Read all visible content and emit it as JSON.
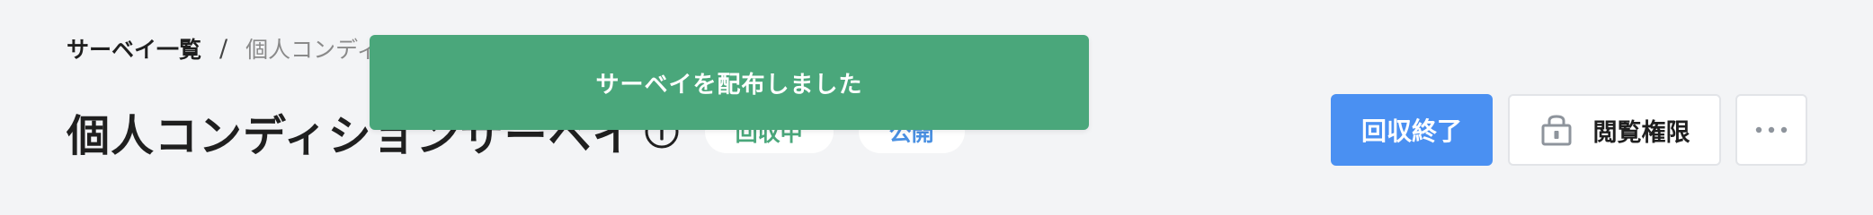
{
  "breadcrumb": {
    "parent": "サーベイ一覧",
    "separator": "/",
    "current": "個人コンディ"
  },
  "header": {
    "title": "個人コンディションサーベイ",
    "status_badge": "回収中",
    "visibility_badge": "公開"
  },
  "toast": {
    "message": "サーベイを配布しました"
  },
  "actions": {
    "close_collection": "回収終了",
    "view_permission": "閲覧権限"
  },
  "icons": {
    "info": "info-icon",
    "lock": "lock-icon",
    "more": "more-horizontal-icon"
  },
  "colors": {
    "background": "#f3f4f6",
    "toast": "#4aa77b",
    "primary": "#4a90f2",
    "status_green": "#4aa77b",
    "visibility_blue": "#4a90e2",
    "icon_gray": "#8e949c"
  }
}
